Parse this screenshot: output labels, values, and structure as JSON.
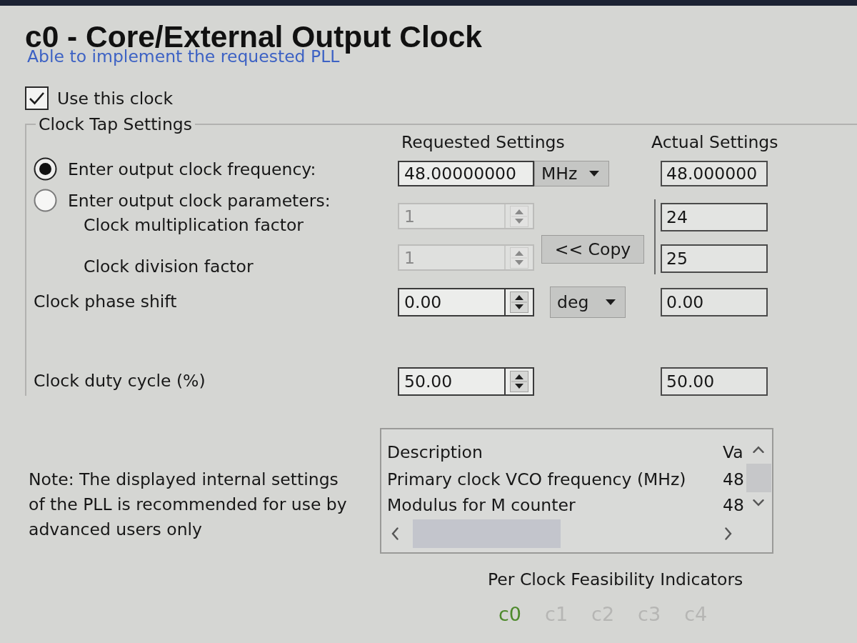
{
  "window": {
    "title": "c0 - Core/External Output Clock",
    "status": "Able to implement the requested PLL"
  },
  "use_clock": {
    "label": "Use this clock",
    "checked": true
  },
  "clock_tap": {
    "label": "Clock Tap Settings",
    "requested_heading": "Requested Settings",
    "actual_heading": "Actual Settings",
    "rows": [
      {
        "kind": "radio",
        "label": "Enter output clock frequency:",
        "selected": true,
        "input": {
          "kind": "text",
          "value": "48.00000000",
          "disabled": false
        },
        "unit": "MHz",
        "actual": "48.000000"
      },
      {
        "kind": "radio",
        "label": "Enter output clock parameters:",
        "selected": false
      },
      {
        "kind": "sub",
        "label": "Clock multiplication factor",
        "input": {
          "kind": "spin",
          "value": "1",
          "disabled": true
        },
        "actual": "24"
      },
      {
        "kind": "sub",
        "label": "Clock division factor",
        "input": {
          "kind": "spin",
          "value": "1",
          "disabled": true
        },
        "actual": "25"
      },
      {
        "kind": "plain",
        "label": "Clock phase shift",
        "input": {
          "kind": "spin",
          "value": "0.00",
          "disabled": false
        },
        "unit": "deg",
        "actual": "0.00"
      },
      {
        "kind": "plain",
        "label": "Clock duty cycle (%)",
        "input": {
          "kind": "spin",
          "value": "50.00",
          "disabled": false
        },
        "actual": "50.00"
      }
    ],
    "copy_button": "<< Copy"
  },
  "note": "Note: The displayed internal settings of the PLL is recommended for use by advanced users only",
  "internal_settings": {
    "columns": [
      "Description",
      "Va"
    ],
    "rows": [
      [
        "Primary clock VCO frequency (MHz)",
        "48"
      ],
      [
        "Modulus for M counter",
        "48"
      ]
    ]
  },
  "feasibility": {
    "label": "Per Clock Feasibility Indicators",
    "clocks": [
      {
        "name": "c0",
        "color": "#4e8a2c"
      },
      {
        "name": "c1",
        "color": "#b6b6b4"
      },
      {
        "name": "c2",
        "color": "#b6b6b4"
      },
      {
        "name": "c3",
        "color": "#b6b6b4"
      },
      {
        "name": "c4",
        "color": "#b6b6b4"
      }
    ]
  }
}
